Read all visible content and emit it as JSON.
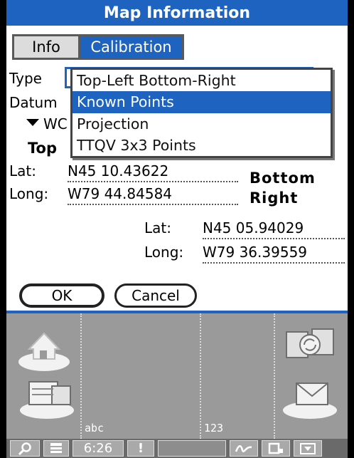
{
  "title": "Map Information",
  "tabs": [
    {
      "label": "Info",
      "active": false
    },
    {
      "label": "Calibration",
      "active": true
    }
  ],
  "form": {
    "type_label": "Type",
    "datum_label": "Datum",
    "datum_value_partial": "WC",
    "top_left_partial": "Top",
    "top_left": {
      "lat_label": "Lat:",
      "lat": "N45 10.43622",
      "long_label": "Long:",
      "long": "W79 44.84584"
    },
    "bottom_right_heading_1": "Bottom",
    "bottom_right_heading_2": "Right",
    "bottom_right": {
      "lat_label": "Lat:",
      "lat": "N45 05.94029",
      "long_label": "Long:",
      "long": "W79 36.39559"
    }
  },
  "dropdown": {
    "options": [
      "Top-Left Bottom-Right",
      "Known Points",
      "Projection",
      "TTQV 3x3 Points"
    ],
    "selected": "Known Points"
  },
  "buttons": {
    "ok": "OK",
    "cancel": "Cancel"
  },
  "graffiti": {
    "left_label": "abc",
    "right_label": "123"
  },
  "status": {
    "time": "6:26"
  },
  "colors": {
    "accent": "#1d63bf",
    "silk_bg": "#9a9a9a",
    "statusbar": "#6a6a6a"
  }
}
